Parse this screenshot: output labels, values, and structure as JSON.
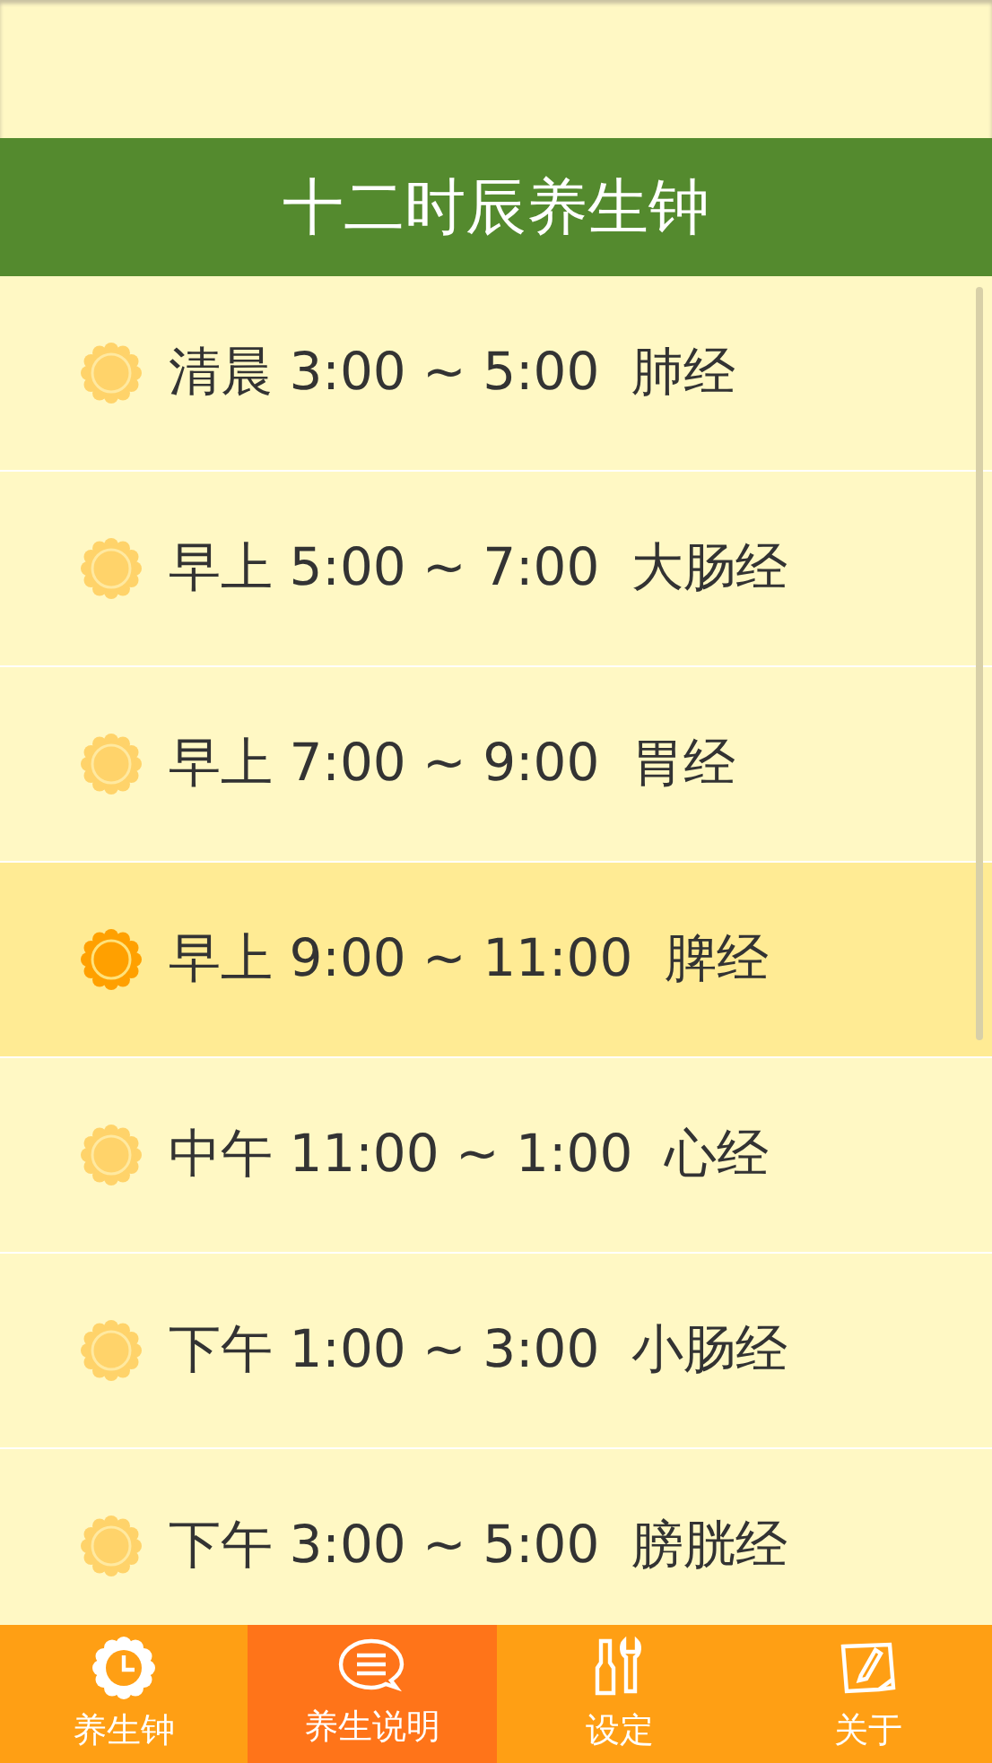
{
  "header": {
    "title": "十二时辰养生钟"
  },
  "periods": [
    {
      "time": "清晨 3:00 ~ 5:00",
      "meridian": "肺经",
      "selected": false
    },
    {
      "time": "早上 5:00 ~ 7:00",
      "meridian": "大肠经",
      "selected": false
    },
    {
      "time": "早上 7:00 ~ 9:00",
      "meridian": "胃经",
      "selected": false
    },
    {
      "time": "早上 9:00 ~ 11:00",
      "meridian": "脾经",
      "selected": true
    },
    {
      "time": "中午 11:00 ~ 1:00",
      "meridian": "心经",
      "selected": false
    },
    {
      "time": "下午 1:00 ~ 3:00",
      "meridian": "小肠经",
      "selected": false
    },
    {
      "time": "下午 3:00 ~ 5:00",
      "meridian": "膀胱经",
      "selected": false
    }
  ],
  "tabs": [
    {
      "kind": "clock",
      "label": "养生钟",
      "selected": false
    },
    {
      "kind": "chat",
      "label": "养生说明",
      "selected": true
    },
    {
      "kind": "tools",
      "label": "设定",
      "selected": false
    },
    {
      "kind": "note",
      "label": "关于",
      "selected": false
    }
  ]
}
